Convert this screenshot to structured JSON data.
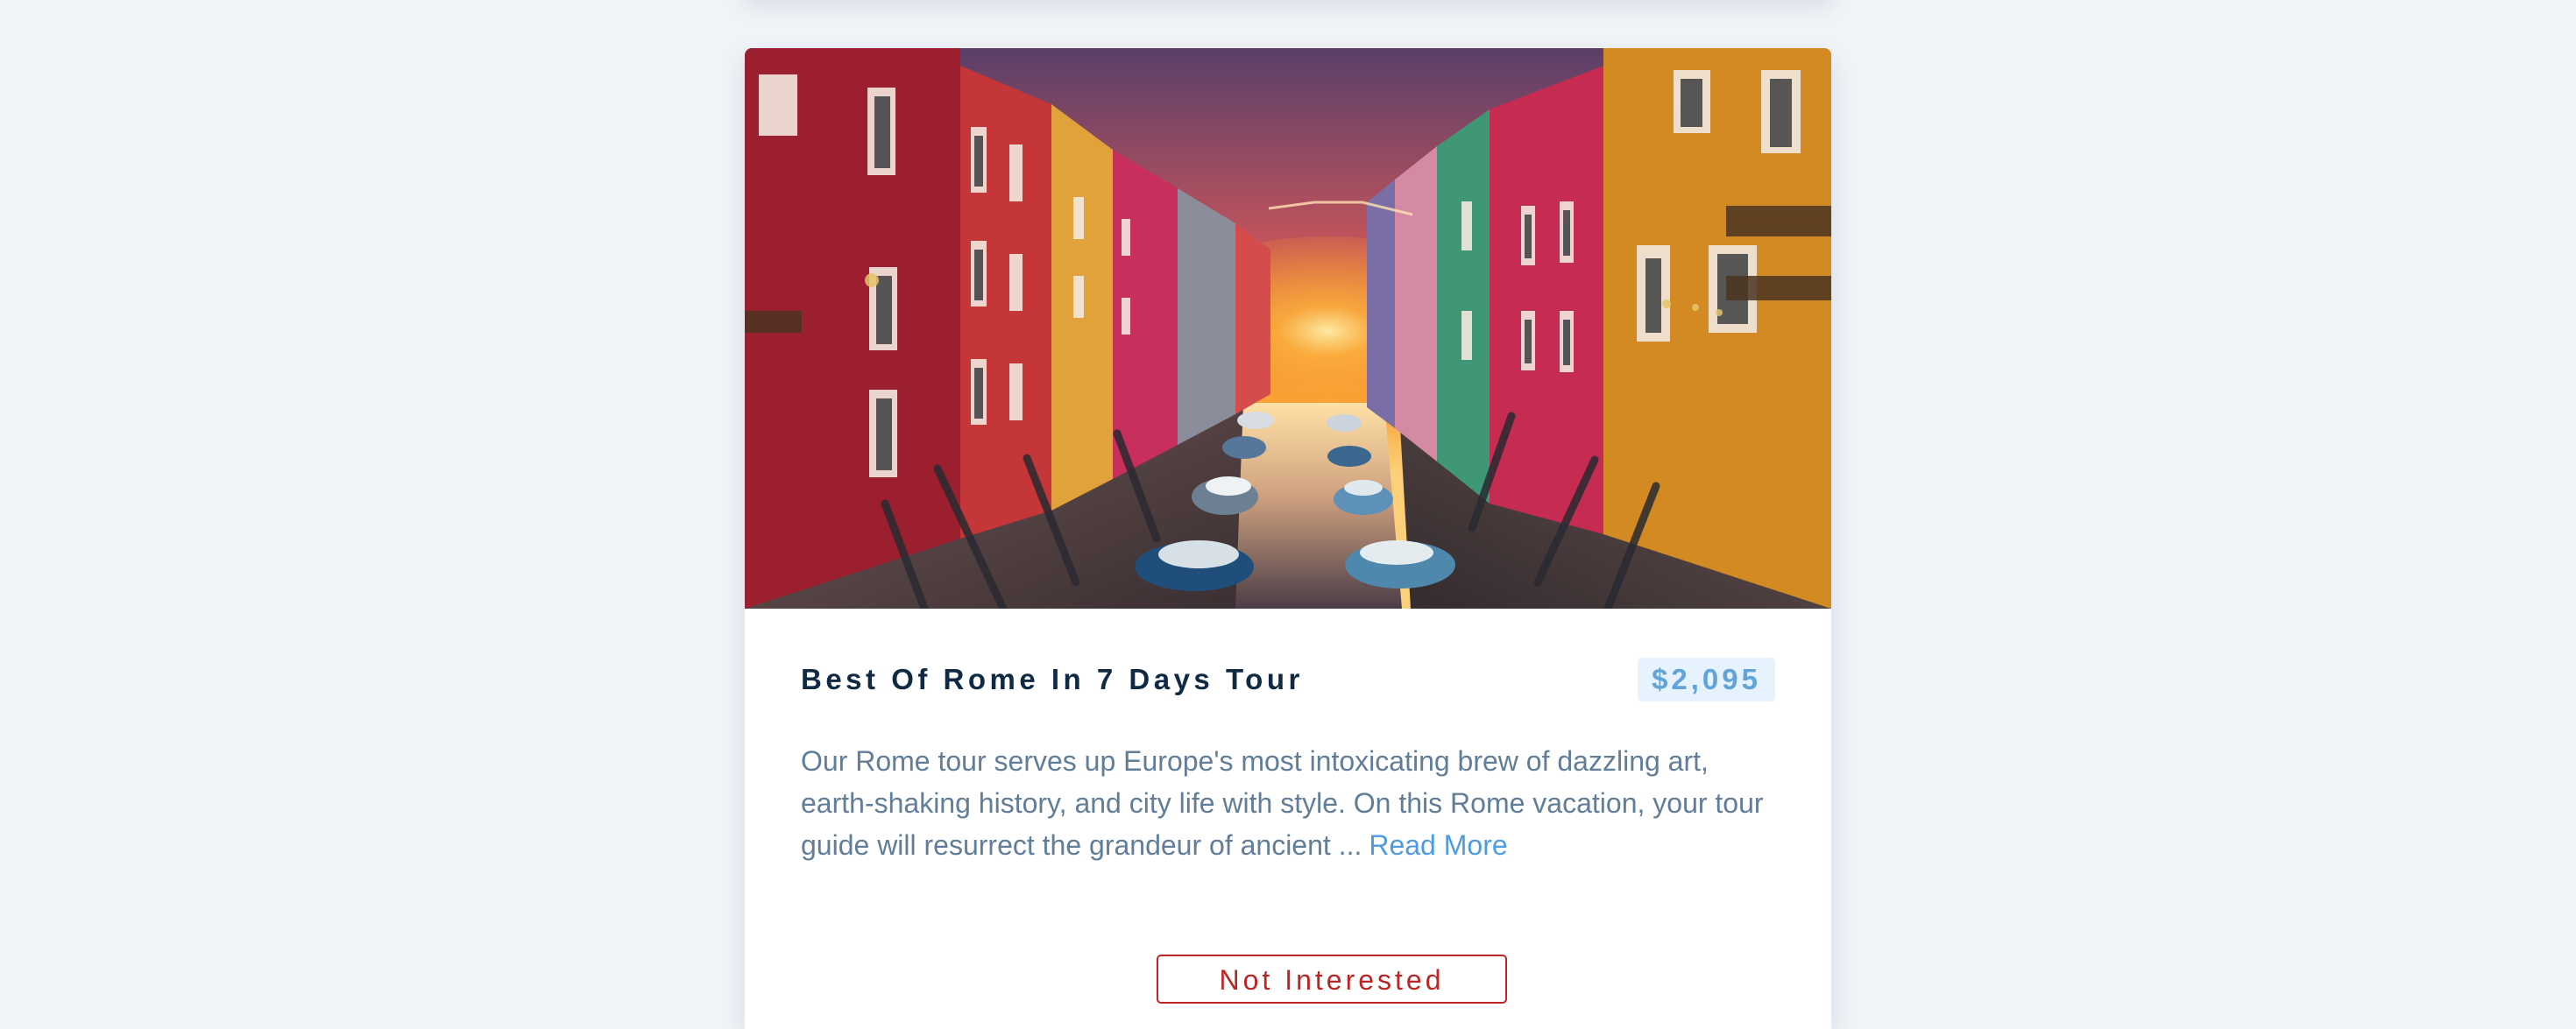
{
  "tour": {
    "image_alt": "Best Of Rome In 7 Days Tour",
    "name": "Best Of Rome In 7 Days Tour",
    "price": "$2,095",
    "description": "Our Rome tour serves up Europe's most intoxicating brew of dazzling art, earth-shaking history, and city life with style. On this Rome vacation, your tour guide will resurrect the grandeur of ancient ...",
    "read_more_label": "Read More",
    "not_interested_label": "Not Interested"
  },
  "colors": {
    "page_background": "#f0f4f8",
    "title": "#102a43",
    "price_text": "#63a4d8",
    "price_background": "#e6f3fe",
    "description": "#617d98",
    "read_more": "#4f9be0",
    "not_interested": "#bb2525"
  }
}
